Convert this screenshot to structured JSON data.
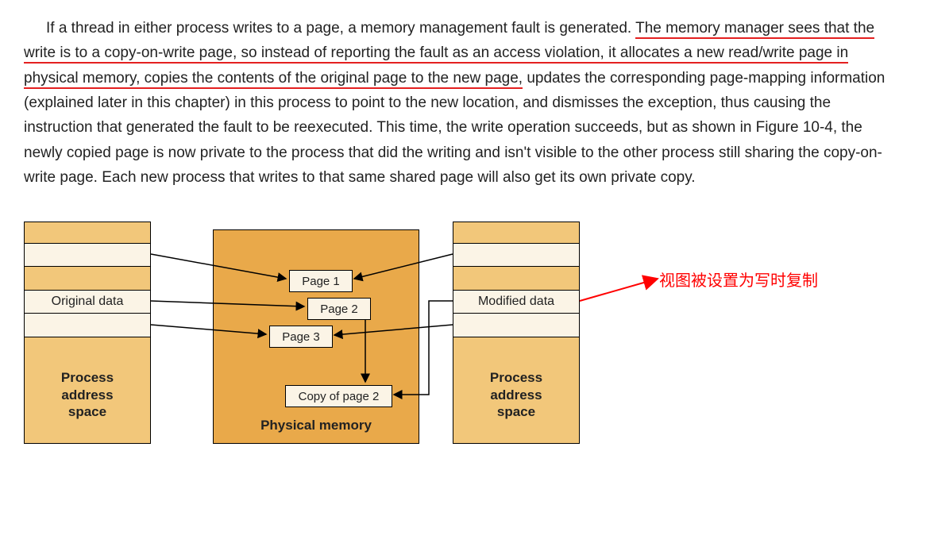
{
  "paragraph": {
    "leading_indent": "",
    "part1": "If a thread in either process writes to a page, a memory management fault is generated. ",
    "underlined": "The memory manager sees that the write is to a copy-on-write page, so instead of reporting the fault as an access violation, it allocates a new read/write page in physical memory, copies the contents of the original page to the new page,",
    "part2": " updates the corresponding page-mapping information (explained later in this chapter) in this process to point to the new location, and dismisses the exception, thus causing the instruction that generated the fault to be reexecuted. This time, the write operation succeeds, but as shown in Figure 10-4, the newly copied page is now private to the process that did the writing and isn't visible to the other process still sharing the copy-on-write page. Each new process that writes to that same shared page will also get its own private copy."
  },
  "diagram": {
    "left_box": {
      "data_label": "Original data",
      "caption_line1": "Process",
      "caption_line2": "address",
      "caption_line3": "space"
    },
    "right_box": {
      "data_label": "Modified data",
      "caption_line1": "Process",
      "caption_line2": "address",
      "caption_line3": "space"
    },
    "phys": {
      "page1": "Page 1",
      "page2": "Page 2",
      "page3": "Page 3",
      "copy2": "Copy of page 2",
      "caption": "Physical memory"
    },
    "annotation": "视图被设置为写时复制"
  },
  "chart_data": {
    "type": "diagram",
    "description": "Copy-on-write memory diagram",
    "nodes": [
      {
        "id": "procA",
        "label": "Process address space",
        "data_row": "Original data"
      },
      {
        "id": "phys",
        "label": "Physical memory",
        "pages": [
          "Page 1",
          "Page 2",
          "Page 3",
          "Copy of page 2"
        ]
      },
      {
        "id": "procB",
        "label": "Process address space",
        "data_row": "Modified data"
      }
    ],
    "edges": [
      {
        "from": "procA.stripe_top",
        "to": "phys.Page 1"
      },
      {
        "from": "procA.Original data",
        "to": "phys.Page 2"
      },
      {
        "from": "procA.stripe_bottom",
        "to": "phys.Page 3"
      },
      {
        "from": "procB.stripe_top",
        "to": "phys.Page 1"
      },
      {
        "from": "procB.stripe_bottom",
        "to": "phys.Page 3"
      },
      {
        "from": "phys.Page 2",
        "to": "phys.Copy of page 2",
        "style": "down"
      },
      {
        "from": "procB.Modified data",
        "to": "phys.Copy of page 2"
      },
      {
        "from": "procB.Modified data",
        "to": "annotation",
        "style": "red-arrow",
        "label": "视图被设置为写时复制"
      }
    ]
  }
}
